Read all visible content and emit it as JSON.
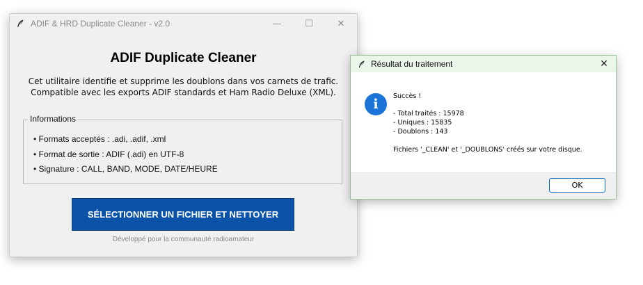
{
  "main_window": {
    "title": "ADIF & HRD Duplicate Cleaner - v2.0",
    "controls": {
      "minimize": "—",
      "maximize": "☐",
      "close": "✕"
    },
    "heading": "ADIF Duplicate Cleaner",
    "description_line1": "Cet utilitaire identifie et supprime les doublons dans vos carnets de trafic.",
    "description_line2": "Compatible avec les exports ADIF standards et Ham Radio Deluxe (XML).",
    "info": {
      "legend": "Informations",
      "items": [
        "• Formats acceptés : .adi, .adif, .xml",
        "• Format de sortie : ADIF (.adi) en UTF-8",
        "• Signature : CALL, BAND, MODE, DATE/HEURE"
      ]
    },
    "action_button": "SÉLECTIONNER UN FICHIER ET NETTOYER",
    "footer": "Développé pour la communauté radioamateur"
  },
  "dialog": {
    "title": "Résultat du traitement",
    "close": "✕",
    "icon_glyph": "i",
    "lines": [
      "Succès !",
      "- Total traités : 15978",
      "- Uniques : 15835",
      "- Doublons : 143",
      "Fichiers '_CLEAN' et '_DOUBLONS' créés sur votre disque."
    ],
    "ok_label": "OK"
  },
  "colors": {
    "accent_button": "#0b53a8",
    "info_icon": "#1a73d9",
    "dialog_titlebar": "#eaf6ea"
  },
  "icons": {
    "app": "feather-icon",
    "info": "info-icon"
  }
}
